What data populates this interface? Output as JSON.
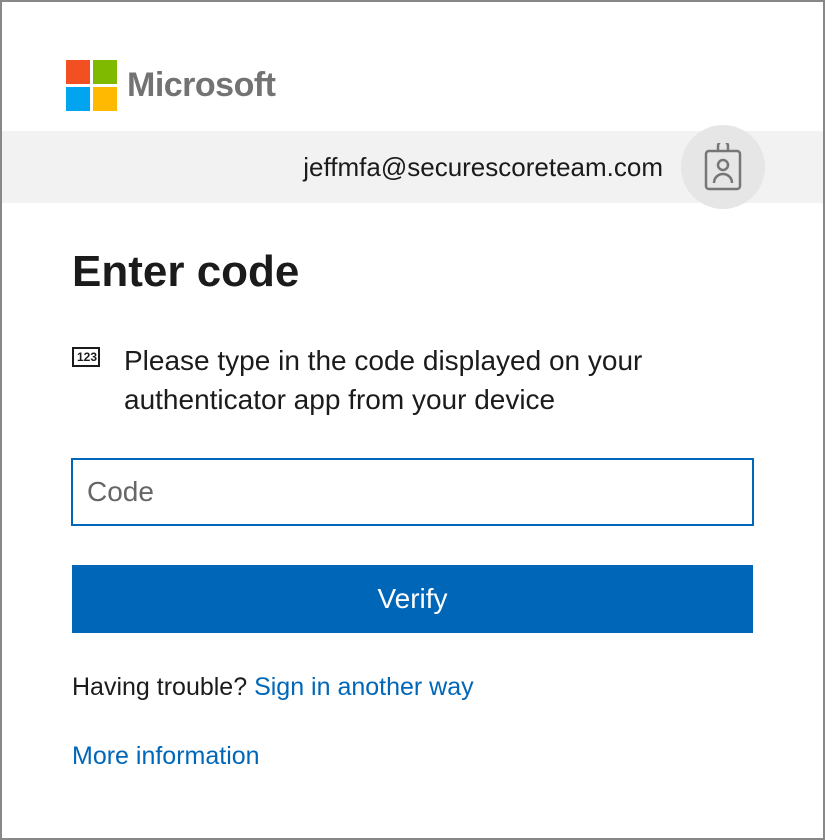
{
  "brand": {
    "name": "Microsoft",
    "colors": {
      "red": "#f25022",
      "green": "#7fba00",
      "blue": "#00a4ef",
      "yellow": "#ffb900"
    }
  },
  "account": {
    "email": "jeffmfa@securescoreteam.com"
  },
  "page": {
    "title": "Enter code",
    "instruction": "Please type in the code displayed on your authenticator app from your device",
    "code_icon_label": "123"
  },
  "form": {
    "code_placeholder": "Code",
    "code_value": "",
    "verify_label": "Verify"
  },
  "links": {
    "trouble_prefix": "Having trouble? ",
    "trouble_link": "Sign in another way",
    "more_info": "More information"
  },
  "colors": {
    "primary": "#0067b8",
    "text": "#1b1b1b",
    "muted": "#737373",
    "bar_bg": "#f2f2f2",
    "badge_bg": "#e6e6e6"
  }
}
